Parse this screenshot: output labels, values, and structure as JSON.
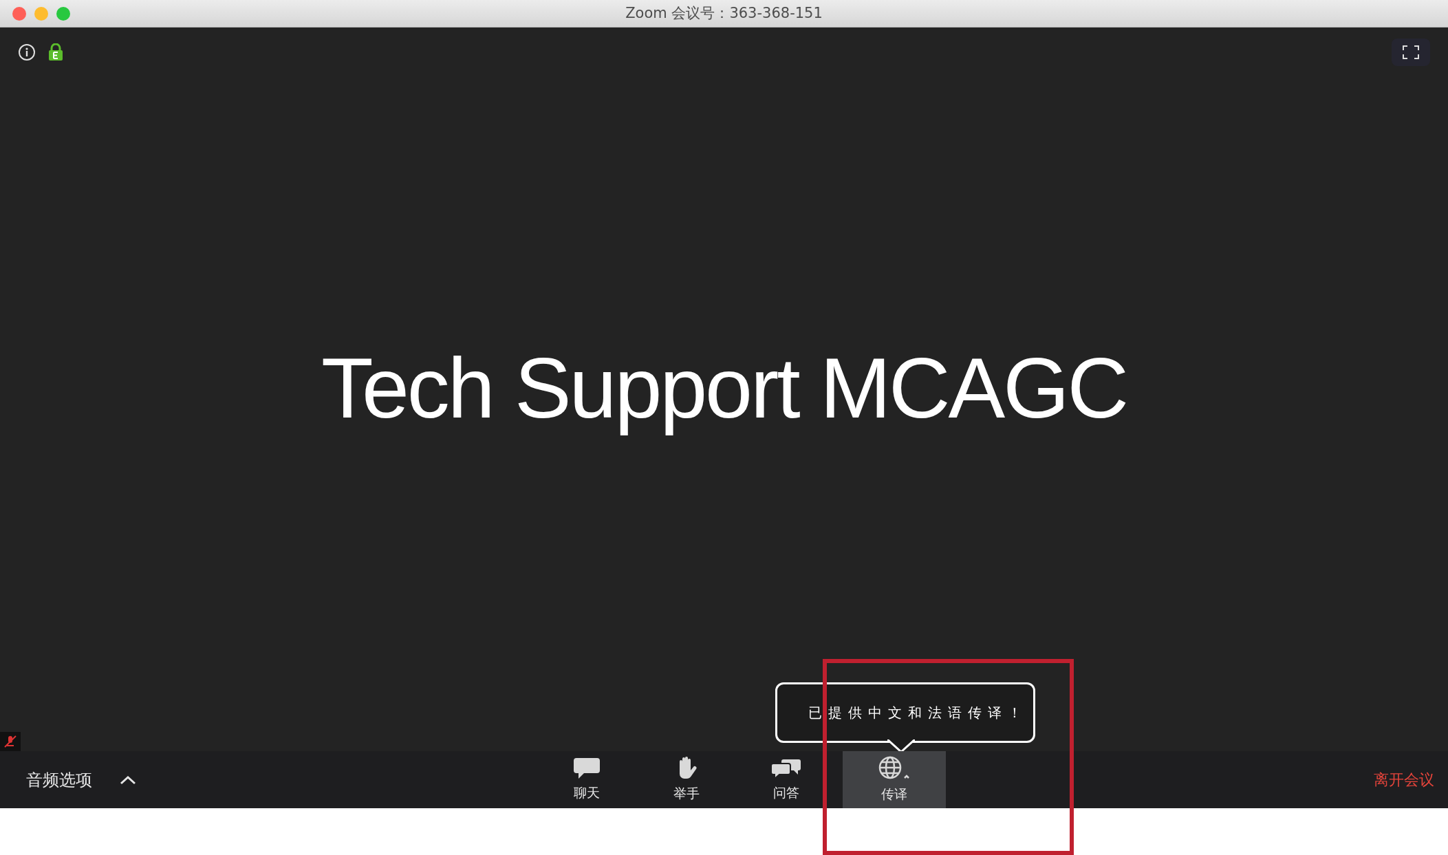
{
  "window": {
    "title": "Zoom 会议号：363-368-151"
  },
  "content": {
    "heading": "Tech Support MCAGC"
  },
  "tooltip": {
    "text": "已提供中文和法语传译！"
  },
  "audio": {
    "label": "音频选项",
    "muted": true
  },
  "toolbar": [
    {
      "kind": "chat",
      "label": "聊天",
      "selected": false
    },
    {
      "kind": "hand",
      "label": "举手",
      "selected": false
    },
    {
      "kind": "qa",
      "label": "问答",
      "selected": false
    },
    {
      "kind": "globe",
      "label": "传译",
      "selected": true
    }
  ],
  "leave": {
    "label": "离开会议"
  }
}
